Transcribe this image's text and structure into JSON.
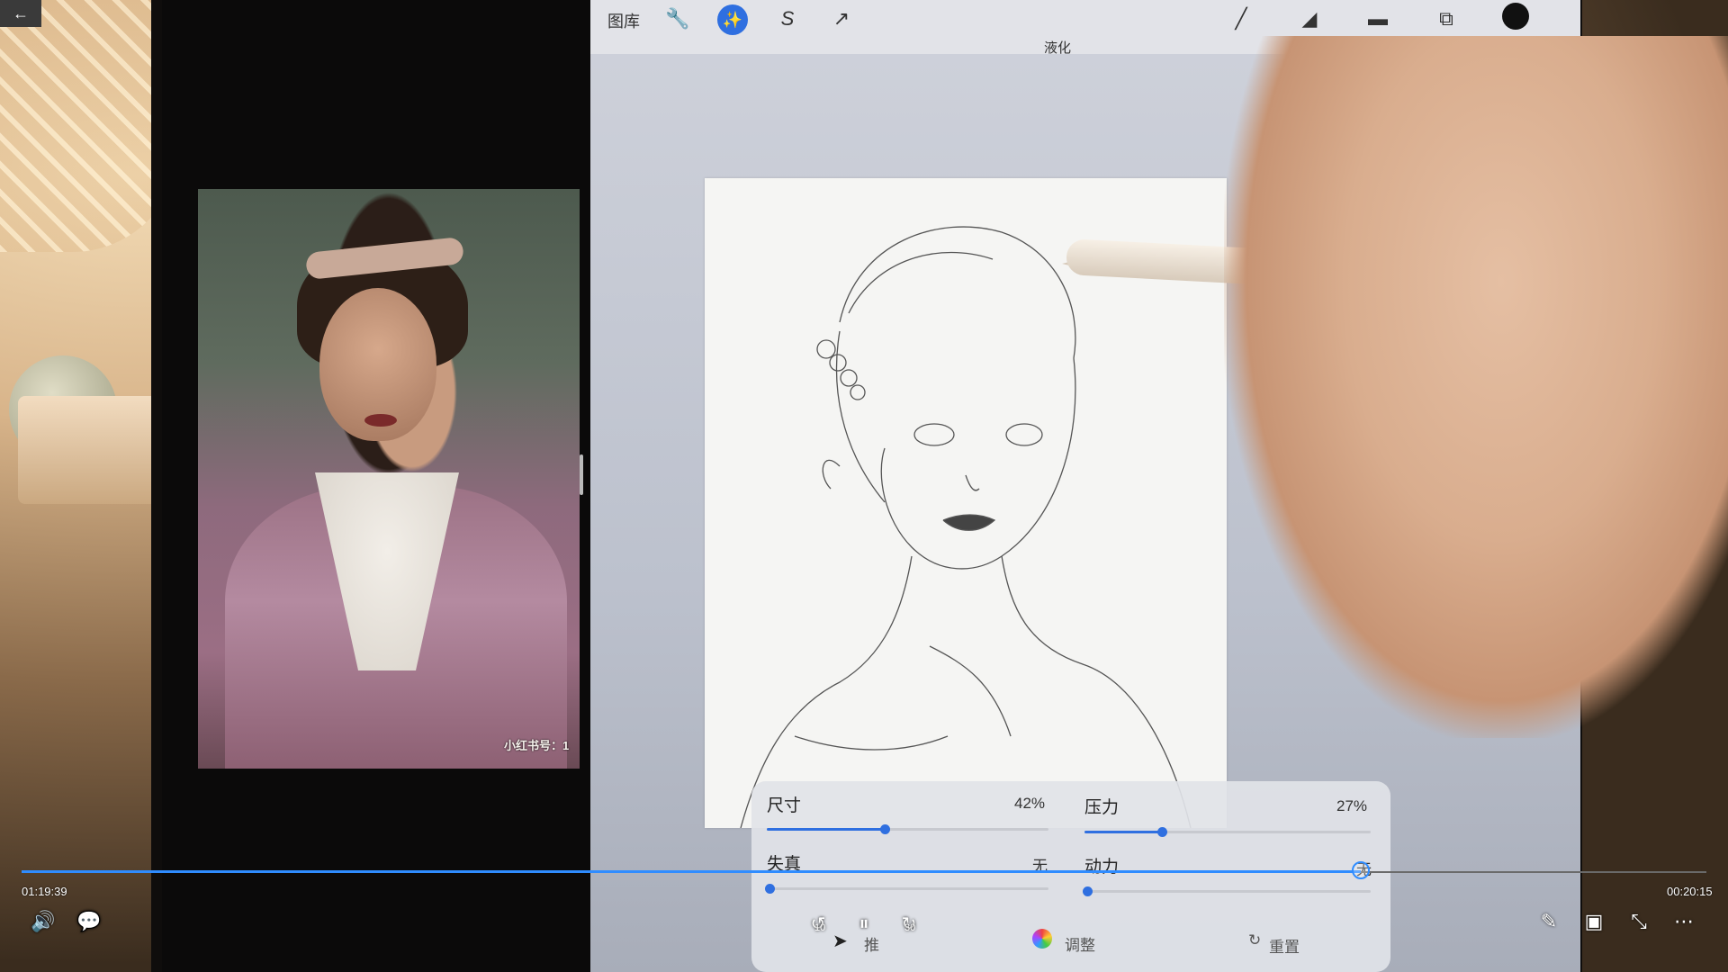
{
  "procreate": {
    "toolbar": {
      "gallery_label": "图库",
      "mode_label": "液化"
    },
    "liquify_panel": {
      "size_label": "尺寸",
      "size_value": "42%",
      "size_fraction": 0.42,
      "pressure_label": "压力",
      "pressure_value": "27%",
      "pressure_fraction": 0.27,
      "distortion_label": "失真",
      "distortion_value": "无",
      "momentum_label": "动力",
      "momentum_value": "无",
      "mode_button_label": "推",
      "adjust_button_label": "调整",
      "reset_button_label": "重置"
    }
  },
  "reference_photo": {
    "watermark": "小红书号：1"
  },
  "player": {
    "elapsed": "01:19:39",
    "remaining": "00:20:15",
    "progress_fraction": 0.795,
    "rewind_label": "10",
    "forward_label": "30",
    "accent_color": "#2f8cff"
  }
}
